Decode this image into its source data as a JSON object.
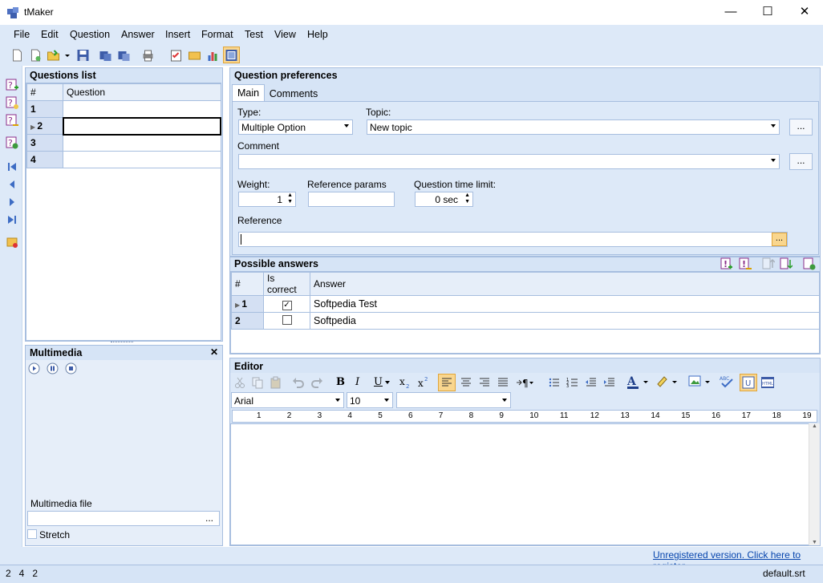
{
  "window": {
    "title": "tMaker",
    "minimize": "—",
    "maximize": "☐",
    "close": "✕"
  },
  "menu": [
    "File",
    "Edit",
    "Question",
    "Answer",
    "Insert",
    "Format",
    "Test",
    "View",
    "Help"
  ],
  "questions": {
    "title": "Questions list",
    "headers": [
      "#",
      "Question"
    ],
    "rows": [
      "1",
      "2",
      "3",
      "4"
    ]
  },
  "multimedia": {
    "title": "Multimedia",
    "close": "✕",
    "file_label": "Multimedia file",
    "browse": "...",
    "stretch": "Stretch"
  },
  "prefs": {
    "title": "Question preferences",
    "tabs": [
      "Main",
      "Comments"
    ],
    "type_label": "Type:",
    "type_value": "Multiple Option",
    "topic_label": "Topic:",
    "topic_value": "New topic",
    "browse": "...",
    "comment_label": "Comment",
    "weight_label": "Weight:",
    "weight_value": "1",
    "ref_params_label": "Reference params",
    "time_label": "Question time limit:",
    "time_value": "0 sec",
    "reference_label": "Reference",
    "ref_btn": "..."
  },
  "answers": {
    "title": "Possible answers",
    "headers": [
      "#",
      "Is correct",
      "Answer"
    ],
    "rows": [
      {
        "n": "1",
        "correct": true,
        "text": "Softpedia Test"
      },
      {
        "n": "2",
        "correct": false,
        "text": "Softpedia"
      }
    ]
  },
  "editor": {
    "title": "Editor",
    "font": "Arial",
    "size": "10",
    "style": "",
    "ruler": [
      "1",
      "2",
      "3",
      "4",
      "5",
      "6",
      "7",
      "8",
      "9",
      "10",
      "11",
      "12",
      "13",
      "14",
      "15",
      "16",
      "17",
      "18",
      "19"
    ],
    "bold": "B",
    "italic": "I",
    "underline": "U"
  },
  "link": "Unregistered version. Click here to register.",
  "status": {
    "left": "2   4   2",
    "right": "default.srt"
  },
  "colors": {
    "panel": "#d6e4f6",
    "border": "#a7bedf",
    "link": "#0645ad",
    "accent": "#f5c46b"
  }
}
